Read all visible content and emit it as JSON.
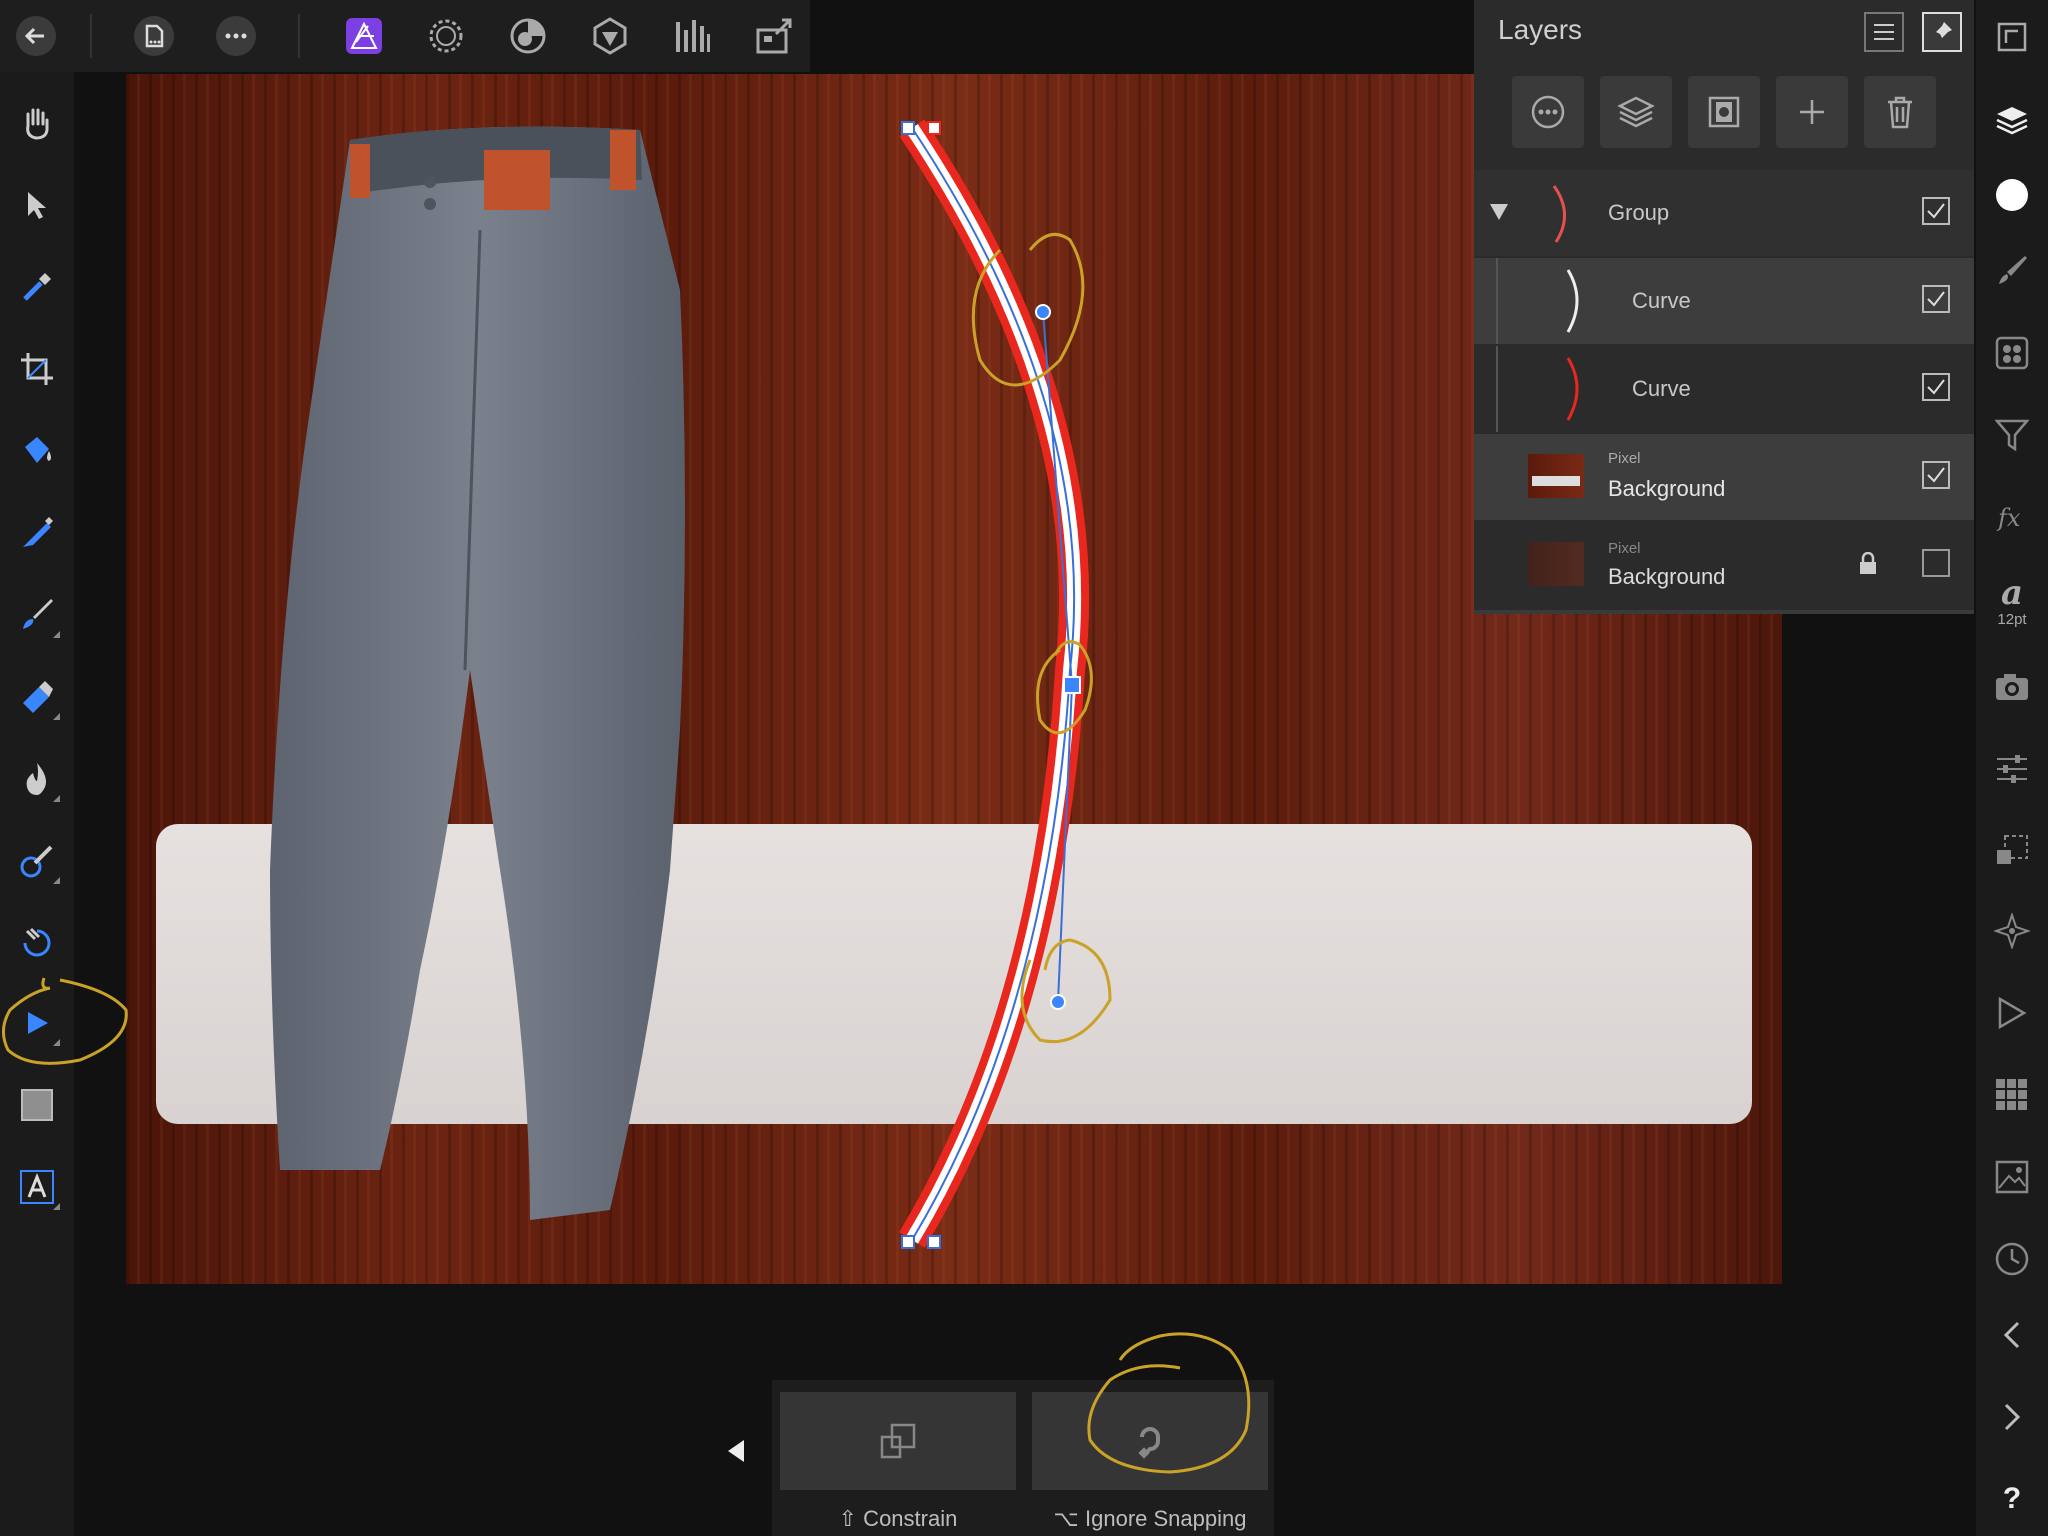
{
  "layers_panel": {
    "title": "Layers",
    "rows": [
      {
        "kind": "",
        "name": "Group",
        "checked": true
      },
      {
        "kind": "",
        "name": "Curve",
        "checked": true
      },
      {
        "kind": "",
        "name": "Curve",
        "checked": true
      },
      {
        "kind": "Pixel",
        "name": "Background",
        "checked": true
      },
      {
        "kind": "Pixel",
        "name": "Background",
        "checked": false,
        "locked": true
      }
    ]
  },
  "right_strip": {
    "font_glyph": "a",
    "font_size": "12pt"
  },
  "context_toolbar": {
    "constrain_label": "⇧ Constrain",
    "ignore_snapping_label": "⌥ Ignore Snapping"
  },
  "help": "?",
  "colors": {
    "accent": "#3a86ff",
    "curve_red": "#e8281e",
    "persona_purple": "#7b3fe4",
    "annotation": "#c9a227"
  },
  "icons": {
    "topbar": [
      "back-arrow-icon",
      "document-icon",
      "more-icon",
      "photo-persona-icon",
      "liquify-persona-icon",
      "develop-persona-icon",
      "tone-mapping-persona-icon",
      "export-persona-icon",
      "export-icon"
    ],
    "tools": [
      "hand-icon",
      "move-icon",
      "color-picker-icon",
      "crop-icon",
      "flood-fill-icon",
      "selection-brush-icon",
      "paint-brush-icon",
      "erase-brush-icon",
      "dodge-burn-icon",
      "healing-brush-icon",
      "clone-brush-icon",
      "node-tool-icon",
      "rectangle-icon",
      "text-tool-icon"
    ]
  }
}
